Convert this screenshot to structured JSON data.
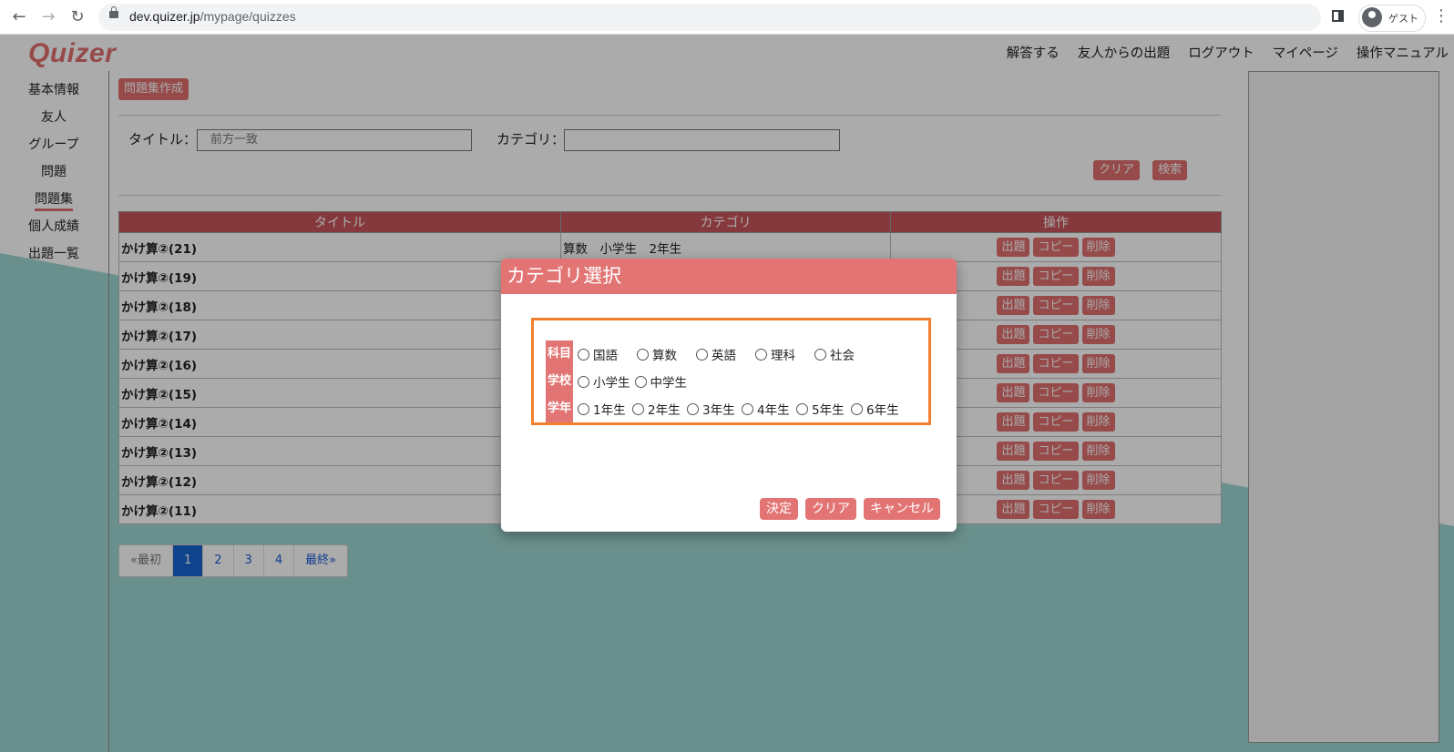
{
  "browser": {
    "url_host": "dev.quizer.jp",
    "url_path": "/mypage/quizzes",
    "profile_label": "ゲスト"
  },
  "header": {
    "logo": "Quizer",
    "nav": [
      "解答する",
      "友人からの出題",
      "ログアウト",
      "マイページ",
      "操作マニュアル"
    ]
  },
  "sidebar": {
    "items": [
      "基本情報",
      "友人",
      "グループ",
      "問題",
      "問題集",
      "個人成績",
      "出題一覧"
    ],
    "active_index": 4
  },
  "toolbar": {
    "create_label": "問題集作成"
  },
  "search": {
    "title_label": "タイトル：",
    "title_placeholder": "前方一致",
    "category_label": "カテゴリ：",
    "clear_label": "クリア",
    "search_label": "検索"
  },
  "table": {
    "headers": [
      "タイトル",
      "カテゴリ",
      "操作"
    ],
    "actions": [
      "出題",
      "コピー",
      "削除"
    ],
    "rows": [
      {
        "title": "かけ算②(21)",
        "category": "算数　小学生　2年生"
      },
      {
        "title": "かけ算②(19)",
        "category": ""
      },
      {
        "title": "かけ算②(18)",
        "category": ""
      },
      {
        "title": "かけ算②(17)",
        "category": ""
      },
      {
        "title": "かけ算②(16)",
        "category": ""
      },
      {
        "title": "かけ算②(15)",
        "category": ""
      },
      {
        "title": "かけ算②(14)",
        "category": ""
      },
      {
        "title": "かけ算②(13)",
        "category": ""
      },
      {
        "title": "かけ算②(12)",
        "category": ""
      },
      {
        "title": "かけ算②(11)",
        "category": ""
      }
    ]
  },
  "pagination": {
    "first": "«最初",
    "pages": [
      "1",
      "2",
      "3",
      "4"
    ],
    "current": "1",
    "last": "最終»"
  },
  "modal": {
    "title": "カテゴリ選択",
    "rows": [
      {
        "label": "科目",
        "options": [
          "国語",
          "算数",
          "英語",
          "理科",
          "社会"
        ]
      },
      {
        "label": "学校",
        "options": [
          "小学生",
          "中学生"
        ]
      },
      {
        "label": "学年",
        "options": [
          "1年生",
          "2年生",
          "3年生",
          "4年生",
          "5年生",
          "6年生"
        ]
      }
    ],
    "buttons": [
      "決定",
      "クリア",
      "キャンセル"
    ]
  },
  "colors": {
    "brand": "#e06f6f",
    "header_row": "#c8555a",
    "modal_head": "#e37474",
    "highlight_border": "#f08030",
    "teal_background": "#9fd7d2",
    "page_active": "#1766d2"
  }
}
